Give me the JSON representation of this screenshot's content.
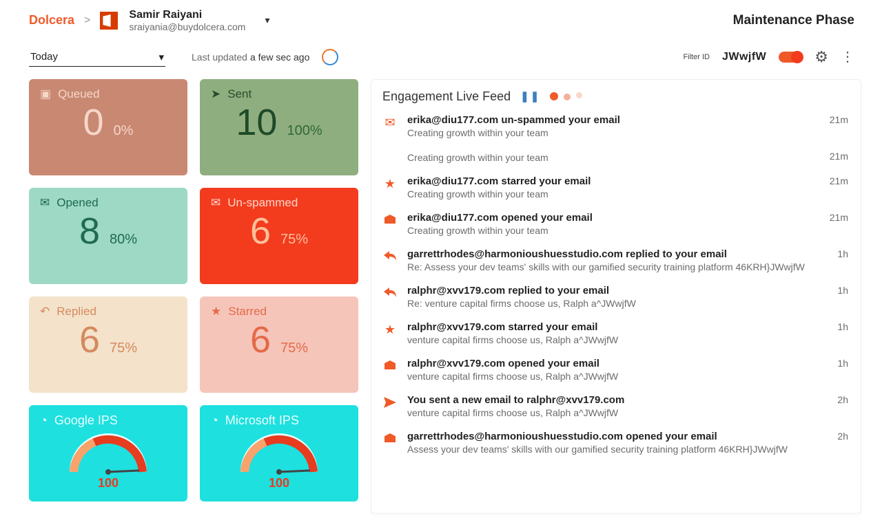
{
  "brand": "Dolcera",
  "user": {
    "name": "Samir Raiyani",
    "email": "sraiyania@buydolcera.com"
  },
  "phase": "Maintenance Phase",
  "range": "Today",
  "updated": {
    "label": "Last updated",
    "ago": "a few sec ago"
  },
  "filter": {
    "label": "Filter ID",
    "value": "JWwjfW"
  },
  "cards": {
    "queued": {
      "label": "Queued",
      "value": "0",
      "pct": "0%"
    },
    "sent": {
      "label": "Sent",
      "value": "10",
      "pct": "100%"
    },
    "opened": {
      "label": "Opened",
      "value": "8",
      "pct": "80%"
    },
    "unspam": {
      "label": "Un-spammed",
      "value": "6",
      "pct": "75%"
    },
    "replied": {
      "label": "Replied",
      "value": "6",
      "pct": "75%"
    },
    "starred": {
      "label": "Starred",
      "value": "6",
      "pct": "75%"
    },
    "google": {
      "label": "Google IPS",
      "value": "100"
    },
    "microsoft": {
      "label": "Microsoft IPS",
      "value": "100"
    }
  },
  "feed": {
    "title": "Engagement Live Feed",
    "items": [
      {
        "icon": "unspam",
        "line1": "erika@diu177.com un-spammed your email",
        "line2": "Creating growth within your team",
        "time": "21m"
      },
      {
        "icon": "none",
        "line1": "",
        "line2": "Creating growth within your team",
        "time": "21m"
      },
      {
        "icon": "star",
        "line1": "erika@diu177.com starred your email",
        "line2": "Creating growth within your team",
        "time": "21m"
      },
      {
        "icon": "open",
        "line1": "erika@diu177.com opened your email",
        "line2": "Creating growth within your team",
        "time": "21m"
      },
      {
        "icon": "reply",
        "line1": "garrettrhodes@harmonioushuesstudio.com replied to your email",
        "line2": "Re: Assess your dev teams' skills with our gamified security training platform 46KRH}JWwjfW",
        "time": "1h"
      },
      {
        "icon": "reply",
        "line1": "ralphr@xvv179.com replied to your email",
        "line2": "Re: venture capital firms choose us, Ralph a^JWwjfW",
        "time": "1h"
      },
      {
        "icon": "star",
        "line1": "ralphr@xvv179.com starred your email",
        "line2": "venture capital firms choose us, Ralph a^JWwjfW",
        "time": "1h"
      },
      {
        "icon": "open",
        "line1": "ralphr@xvv179.com opened your email",
        "line2": "venture capital firms choose us, Ralph a^JWwjfW",
        "time": "1h"
      },
      {
        "icon": "sent",
        "line1": "You sent a new email to ralphr@xvv179.com",
        "line2": "venture capital firms choose us, Ralph a^JWwjfW",
        "time": "2h"
      },
      {
        "icon": "open",
        "line1": "garrettrhodes@harmonioushuesstudio.com opened your email",
        "line2": "Assess your dev teams' skills with our gamified security training platform 46KRH}JWwjfW",
        "time": "2h"
      }
    ]
  },
  "chart_data": [
    {
      "type": "gauge",
      "title": "Google IPS",
      "value": 100,
      "min": 0,
      "max": 100
    },
    {
      "type": "gauge",
      "title": "Microsoft IPS",
      "value": 100,
      "min": 0,
      "max": 100
    }
  ]
}
